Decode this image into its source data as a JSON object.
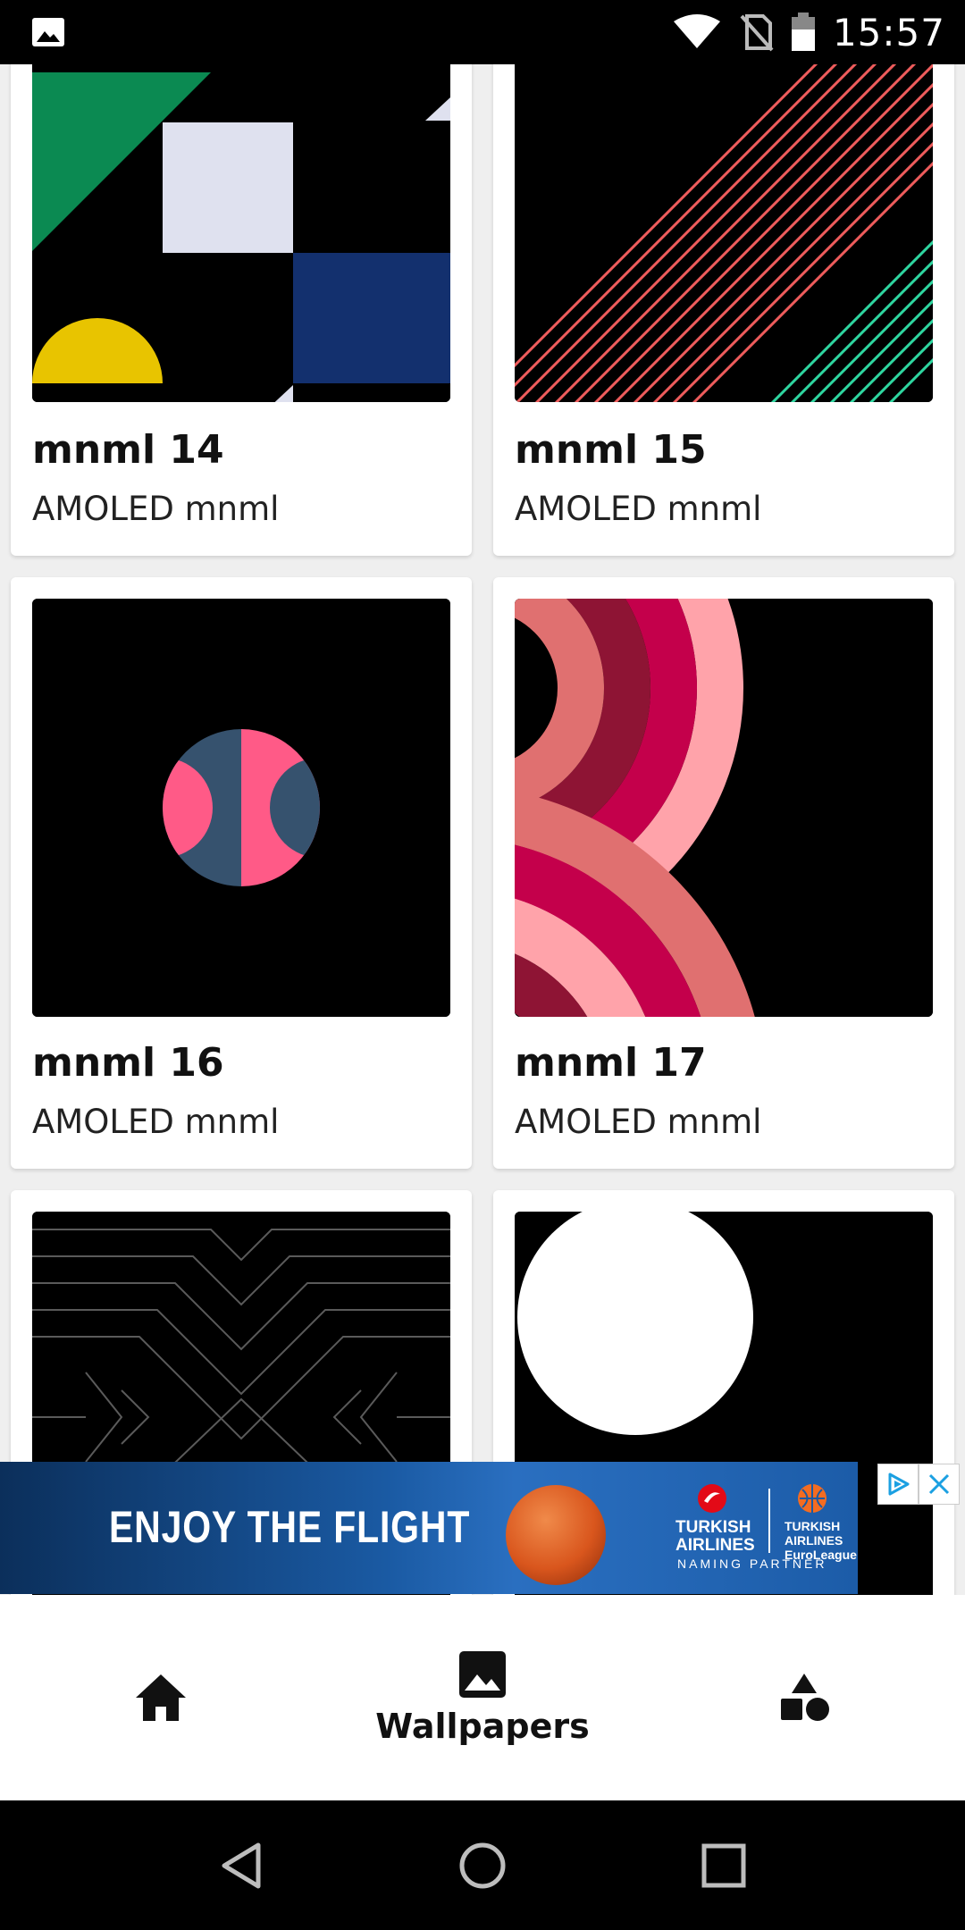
{
  "status_bar": {
    "time": "15:57",
    "icons": [
      "image-notification-icon",
      "wifi-icon",
      "no-sim-icon",
      "battery-icon"
    ]
  },
  "wallpapers": [
    {
      "title": "mnml 14",
      "subtitle": "AMOLED mnml"
    },
    {
      "title": "mnml 15",
      "subtitle": "AMOLED mnml"
    },
    {
      "title": "mnml 16",
      "subtitle": "AMOLED mnml"
    },
    {
      "title": "mnml 17",
      "subtitle": "AMOLED mnml"
    },
    {
      "title": "",
      "subtitle": ""
    },
    {
      "title": "",
      "subtitle": ""
    }
  ],
  "ad": {
    "slogan": "ENJOY THE FLIGHT",
    "airline": "TURKISH\nAIRLINES",
    "league": "TURKISH\nAIRLINES\nEuroLeague",
    "partner": "NAMING PARTNER"
  },
  "bottom_nav": {
    "items": [
      {
        "icon": "home-icon",
        "label": ""
      },
      {
        "icon": "image-icon",
        "label": "Wallpapers"
      },
      {
        "icon": "shapes-icon",
        "label": ""
      }
    ],
    "active": "Wallpapers"
  },
  "colors": {
    "green": "#0b8a52",
    "navy": "#13306e",
    "yellow": "#e8c400",
    "pale": "#dfe1ef",
    "pink": "#ff5a87",
    "slate": "#36526e",
    "crimson": "#c4004b",
    "maroon": "#8e1434",
    "salmon": "#e07070",
    "light_pink": "#ffa3aa",
    "stripe_red": "#ef5c5c",
    "stripe_green": "#2fd6a0"
  }
}
